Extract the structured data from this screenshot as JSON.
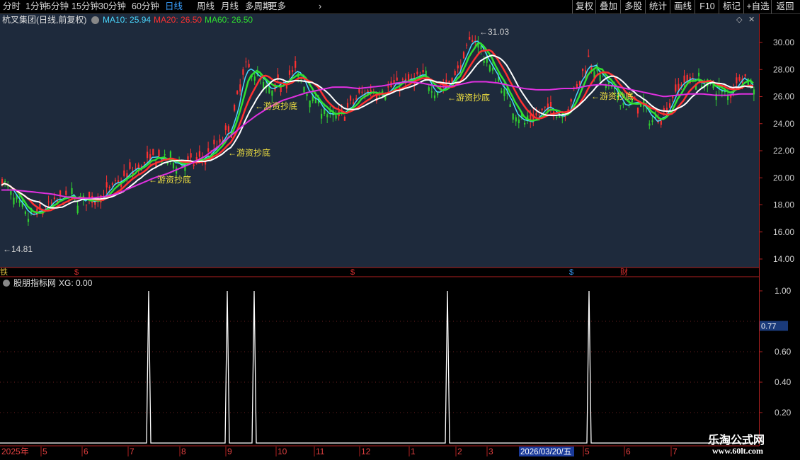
{
  "toolbar": {
    "left_items": [
      "分时",
      "1分钟",
      "5分钟",
      "15分钟",
      "30分钟",
      "60分钟",
      "日线",
      "周线",
      "月线",
      "多周期",
      "更多"
    ],
    "active": "日线",
    "right_items": [
      "复权",
      "叠加",
      "多股",
      "统计",
      "画线",
      "F10",
      "标记",
      "+自选",
      "返回"
    ]
  },
  "main_title": {
    "stock": "杭叉集团(日线,前复权)",
    "ma10": "MA10: 25.94",
    "ma20": "MA20: 26.50",
    "ma60": "MA60: 26.50"
  },
  "price_axis": {
    "ticks": [
      "30.00",
      "28.00",
      "26.00",
      "24.00",
      "22.00",
      "20.00",
      "18.00",
      "16.00",
      "14.00"
    ]
  },
  "annotations": {
    "high": "31.03",
    "low": "14.81",
    "signals": [
      "←游资抄底",
      "←游资抄底",
      "←游资抄底",
      "←游资抄底",
      "←游资抄底"
    ]
  },
  "event_markers": {
    "items": [
      "$",
      "$",
      "$",
      "财",
      "$"
    ],
    "left_tag": "铁"
  },
  "indicator": {
    "name": "股朋指标网",
    "xg": "XG: 0.00",
    "ticks": [
      "1.00",
      "0.60",
      "0.40",
      "0.20"
    ],
    "current": "0.77"
  },
  "date_axis": {
    "year": "2025年",
    "labels": [
      "5",
      "6",
      "7",
      "8",
      "9",
      "10",
      "11",
      "12",
      "1",
      "2",
      "3",
      "5",
      "6",
      "7"
    ],
    "cursor_date": "2026/03/20/五"
  },
  "watermark": {
    "line1": "乐淘公式网",
    "line2": "www.60lt.com"
  },
  "colors": {
    "ma10": "#4ad8ff",
    "ma20": "#ff3030",
    "ma60": "#30e030",
    "ma_long": "#e030e0",
    "up": "#ff3030",
    "down": "#30d030",
    "signal_text": "#f0e040"
  },
  "chart_data": {
    "type": "candlestick",
    "price_ylim": [
      13.5,
      31.5
    ],
    "close_path": [
      19.9,
      18.2,
      17.0,
      17.5,
      18.1,
      18.6,
      18.3,
      18.4,
      18.8,
      19.5,
      20.4,
      20.9,
      21.6,
      21.2,
      21.0,
      21.1,
      21.6,
      22.4,
      23.8,
      28.2,
      27.6,
      26.0,
      27.3,
      27.9,
      26.2,
      25.2,
      24.3,
      25.0,
      26.1,
      26.5,
      26.4,
      27.0,
      27.1,
      27.5,
      26.4,
      27.0,
      28.4,
      30.6,
      28.6,
      27.0,
      25.2,
      24.0,
      24.6,
      25.2,
      24.6,
      26.5,
      28.8,
      27.4,
      26.2,
      25.3,
      25.6,
      24.1,
      24.9,
      26.8,
      27.4,
      27.0,
      26.6,
      26.0,
      27.9,
      26.4
    ],
    "ma_long_path": [
      19.1,
      19.1,
      19.0,
      18.9,
      18.8,
      18.6,
      18.5,
      18.5,
      18.6,
      18.8,
      19.2,
      19.6,
      20.0,
      20.3,
      20.7,
      21.1,
      21.6,
      22.3,
      23.1,
      23.9,
      24.6,
      25.2,
      25.7,
      26.0,
      26.3,
      26.5,
      26.7,
      26.7,
      26.6,
      26.7,
      26.8,
      27.0,
      27.1,
      27.0,
      26.8,
      26.7,
      26.9,
      27.1,
      27.1,
      27.0,
      26.8,
      26.6,
      26.5,
      26.5,
      26.6,
      26.6,
      26.8,
      26.9,
      26.8,
      26.6,
      26.4,
      26.2,
      26.0,
      26.1,
      26.2,
      26.2,
      26.1,
      26.1,
      26.2,
      26.2
    ],
    "indicator_signals_x_index": [
      13,
      20,
      22,
      39,
      52
    ],
    "indicator_ylim": [
      0,
      1.05
    ]
  }
}
